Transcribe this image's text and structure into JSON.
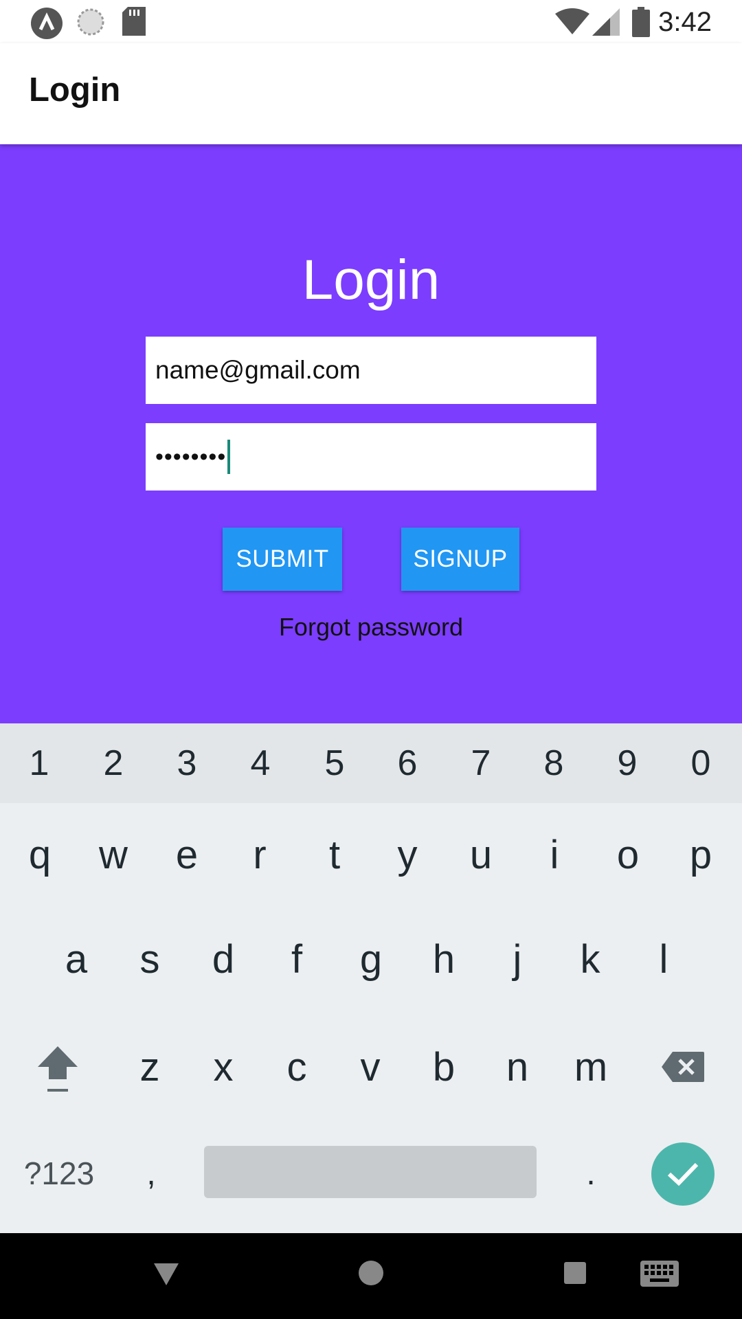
{
  "status_bar": {
    "time": "3:42",
    "icons": [
      "app-launcher-icon",
      "sync-icon",
      "sd-card-icon",
      "wifi-icon",
      "signal-icon",
      "battery-icon"
    ]
  },
  "app_bar": {
    "title": "Login"
  },
  "form": {
    "heading": "Login",
    "email_value": "name@gmail.com",
    "password_mask": "••••••••",
    "submit_label": "SUBMIT",
    "signup_label": "SIGNUP",
    "forgot_label": "Forgot password"
  },
  "keyboard": {
    "numbers": [
      "1",
      "2",
      "3",
      "4",
      "5",
      "6",
      "7",
      "8",
      "9",
      "0"
    ],
    "row1": [
      "q",
      "w",
      "e",
      "r",
      "t",
      "y",
      "u",
      "i",
      "o",
      "p"
    ],
    "row2": [
      "a",
      "s",
      "d",
      "f",
      "g",
      "h",
      "j",
      "k",
      "l"
    ],
    "row3": [
      "z",
      "x",
      "c",
      "v",
      "b",
      "n",
      "m"
    ],
    "symbols_label": "?123",
    "comma": ",",
    "period": "."
  },
  "colors": {
    "content_bg": "#7c3dff",
    "button_bg": "#2196f3",
    "done_key": "#4db6ac"
  }
}
